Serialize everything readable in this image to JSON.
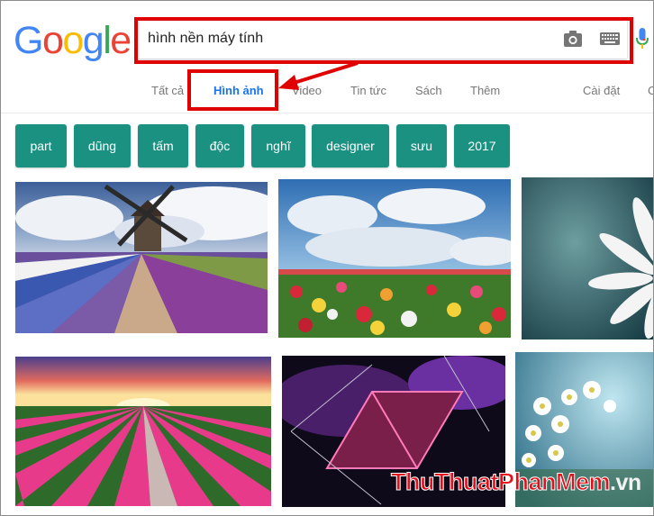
{
  "logo": {
    "text": "Google",
    "colors": [
      "#4285f4",
      "#ea4335",
      "#fbbc05",
      "#4285f4",
      "#34a853",
      "#ea4335"
    ]
  },
  "search": {
    "value": "hình nền máy tính"
  },
  "tabs": [
    {
      "label": "Tất cả"
    },
    {
      "label": "Hình ảnh",
      "active": true
    },
    {
      "label": "Video"
    },
    {
      "label": "Tin tức"
    },
    {
      "label": "Sách"
    },
    {
      "label": "Thêm"
    }
  ],
  "settings_label": "Cài đặt",
  "tools_label_fragment": "C",
  "chips": [
    "part",
    "dũng",
    "tấm",
    "độc",
    "nghĩ",
    "designer",
    "sưu",
    "2017"
  ],
  "images": [
    {
      "subject": "windmill tulip field"
    },
    {
      "subject": "tulip field under cloudy sky"
    },
    {
      "subject": "white daisy closeup"
    },
    {
      "subject": "pink tulip rows at sunset"
    },
    {
      "subject": "abstract purple rhombus"
    },
    {
      "subject": "white daisies blue background"
    }
  ],
  "watermark": {
    "part1": "Thu",
    "part2": "Thuat",
    "part3": "PhanMem",
    "part4": ".vn"
  },
  "annotation_color": "#e00000"
}
